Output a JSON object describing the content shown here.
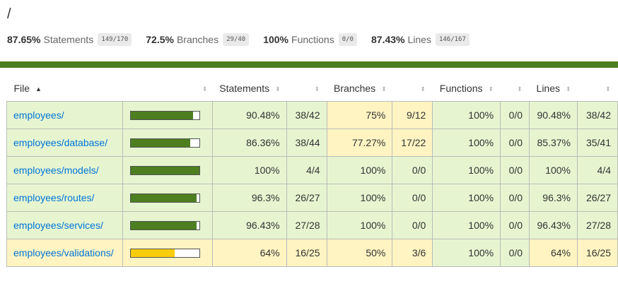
{
  "page": {
    "title": "/"
  },
  "summary": [
    {
      "pct": "87.65%",
      "label": "Statements",
      "fraction": "149/170"
    },
    {
      "pct": "72.5%",
      "label": "Branches",
      "fraction": "29/40"
    },
    {
      "pct": "100%",
      "label": "Functions",
      "fraction": "0/0"
    },
    {
      "pct": "87.43%",
      "label": "Lines",
      "fraction": "146/167"
    }
  ],
  "colors": {
    "high": "#4d7e20",
    "medium": "#f9cd0b",
    "high_bg": "#e6f5d0",
    "medium_bg": "#fff4c2",
    "link": "#0074d9"
  },
  "table": {
    "headers": {
      "file": "File",
      "statements": "Statements",
      "branches": "Branches",
      "functions": "Functions",
      "lines": "Lines"
    },
    "sort_icons": {
      "asc": "▲",
      "both": "⬍"
    },
    "rows": [
      {
        "file": "employees/",
        "coverage": 0.9048,
        "level": "high",
        "stmt_pct": "90.48%",
        "stmt_frac": "38/42",
        "stmt_level": "high",
        "branch_pct": "75%",
        "branch_frac": "9/12",
        "branch_level": "medium",
        "func_pct": "100%",
        "func_frac": "0/0",
        "func_level": "high",
        "line_pct": "90.48%",
        "line_frac": "38/42",
        "line_level": "high"
      },
      {
        "file": "employees/database/",
        "coverage": 0.8636,
        "level": "high",
        "stmt_pct": "86.36%",
        "stmt_frac": "38/44",
        "stmt_level": "high",
        "branch_pct": "77.27%",
        "branch_frac": "17/22",
        "branch_level": "medium",
        "func_pct": "100%",
        "func_frac": "0/0",
        "func_level": "high",
        "line_pct": "85.37%",
        "line_frac": "35/41",
        "line_level": "high"
      },
      {
        "file": "employees/models/",
        "coverage": 1.0,
        "level": "high",
        "stmt_pct": "100%",
        "stmt_frac": "4/4",
        "stmt_level": "high",
        "branch_pct": "100%",
        "branch_frac": "0/0",
        "branch_level": "high",
        "func_pct": "100%",
        "func_frac": "0/0",
        "func_level": "high",
        "line_pct": "100%",
        "line_frac": "4/4",
        "line_level": "high"
      },
      {
        "file": "employees/routes/",
        "coverage": 0.963,
        "level": "high",
        "stmt_pct": "96.3%",
        "stmt_frac": "26/27",
        "stmt_level": "high",
        "branch_pct": "100%",
        "branch_frac": "0/0",
        "branch_level": "high",
        "func_pct": "100%",
        "func_frac": "0/0",
        "func_level": "high",
        "line_pct": "96.3%",
        "line_frac": "26/27",
        "line_level": "high"
      },
      {
        "file": "employees/services/",
        "coverage": 0.9643,
        "level": "high",
        "stmt_pct": "96.43%",
        "stmt_frac": "27/28",
        "stmt_level": "high",
        "branch_pct": "100%",
        "branch_frac": "0/0",
        "branch_level": "high",
        "func_pct": "100%",
        "func_frac": "0/0",
        "func_level": "high",
        "line_pct": "96.43%",
        "line_frac": "27/28",
        "line_level": "high"
      },
      {
        "file": "employees/validations/",
        "coverage": 0.64,
        "level": "medium",
        "stmt_pct": "64%",
        "stmt_frac": "16/25",
        "stmt_level": "medium",
        "branch_pct": "50%",
        "branch_frac": "3/6",
        "branch_level": "medium",
        "func_pct": "100%",
        "func_frac": "0/0",
        "func_level": "high",
        "line_pct": "64%",
        "line_frac": "16/25",
        "line_level": "medium"
      }
    ]
  }
}
